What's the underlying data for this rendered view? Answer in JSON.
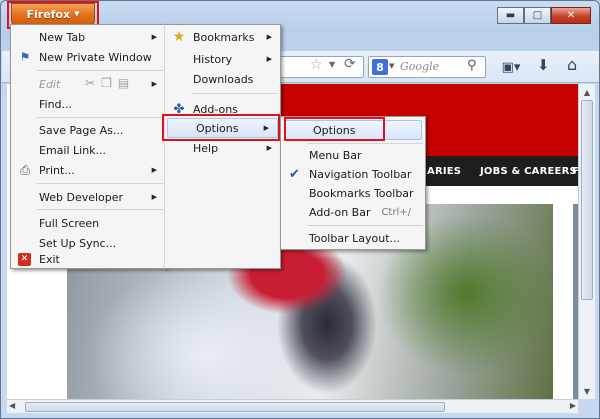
{
  "app_button": {
    "label": "Firefox"
  },
  "window_controls": {
    "minimize": "▬",
    "maximize": "□",
    "close": "✕"
  },
  "search": {
    "engine_letter": "8",
    "placeholder": "Google"
  },
  "page": {
    "nav_items": [
      "ARIES",
      "JOBS & CAREERS",
      "F"
    ]
  },
  "menu_left": {
    "items": [
      {
        "label": "New Tab",
        "has_submenu": true
      },
      {
        "label": "New Private Window",
        "icon": "private-window-icon"
      },
      {
        "label": "Edit",
        "disabled": true,
        "has_submenu": true
      },
      {
        "label": "Find..."
      },
      {
        "label": "Save Page As..."
      },
      {
        "label": "Email Link..."
      },
      {
        "label": "Print...",
        "icon": "printer-icon",
        "has_submenu": true
      },
      {
        "label": "Web Developer",
        "has_submenu": true
      },
      {
        "label": "Full Screen"
      },
      {
        "label": "Set Up Sync..."
      },
      {
        "label": "Exit",
        "icon": "exit-icon"
      }
    ]
  },
  "menu_mid": {
    "items": [
      {
        "label": "Bookmarks",
        "icon": "star-icon",
        "has_submenu": true
      },
      {
        "label": "History",
        "has_submenu": true
      },
      {
        "label": "Downloads"
      },
      {
        "label": "Add-ons",
        "icon": "puzzle-icon"
      },
      {
        "label": "Options",
        "has_submenu": true,
        "active": true
      },
      {
        "label": "Help",
        "has_submenu": true
      }
    ]
  },
  "menu_options": {
    "items": [
      {
        "label": "Options",
        "active": true
      },
      {
        "label": "Menu Bar",
        "checked": false
      },
      {
        "label": "Navigation Toolbar",
        "checked": true
      },
      {
        "label": "Bookmarks Toolbar",
        "checked": false
      },
      {
        "label": "Add-on Bar",
        "checked": false,
        "shortcut": "Ctrl+/"
      },
      {
        "label": "Toolbar Layout..."
      }
    ]
  },
  "highlight_color": "#e0101c",
  "accent_color": "#e4701c"
}
